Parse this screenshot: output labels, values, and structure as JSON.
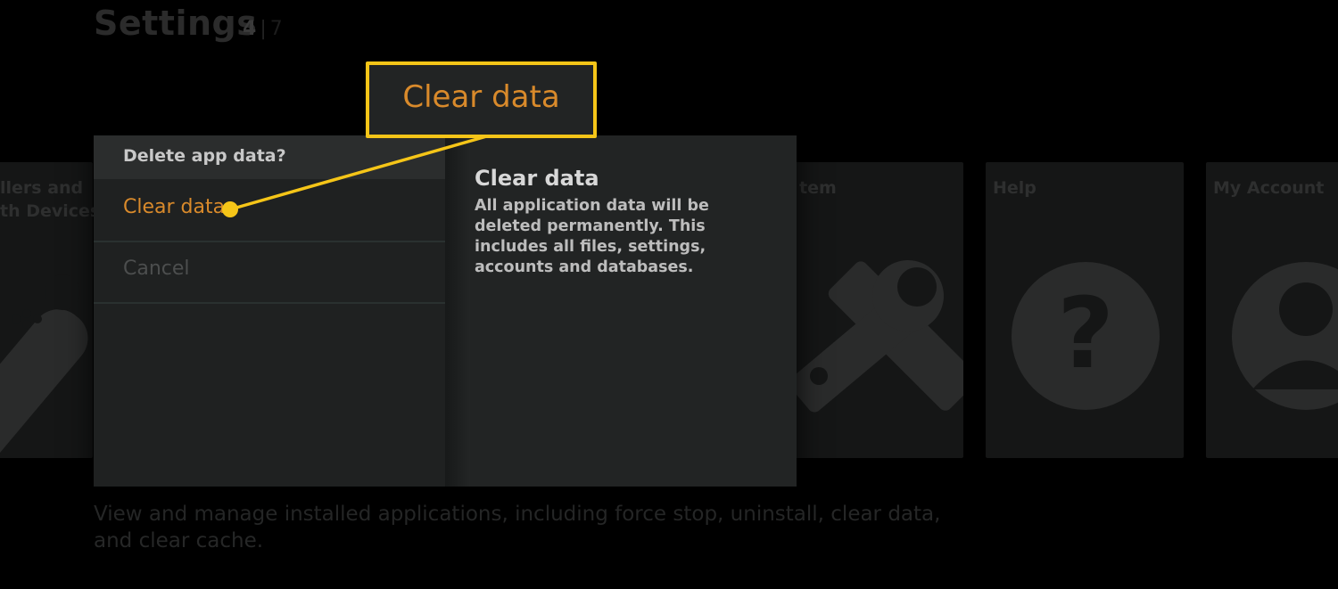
{
  "background": {
    "title": "Settings",
    "counter": {
      "current": "4",
      "separator": "|",
      "total": "7"
    },
    "tiles": [
      {
        "label": "llers and\nth Devices",
        "icon": "remote-icon"
      },
      {
        "label": "tem",
        "icon": "tools-icon"
      },
      {
        "label": "Help",
        "icon": "help-icon"
      },
      {
        "label": "My Account",
        "icon": "account-icon"
      }
    ],
    "description": "View and manage installed applications, including force stop, uninstall, clear data, and clear cache."
  },
  "dialog": {
    "heading": "Delete app data?",
    "options": [
      {
        "label": "Clear data",
        "selected": true
      },
      {
        "label": "Cancel",
        "selected": false
      }
    ],
    "detail": {
      "title": "Clear data",
      "body": "All application data will be deleted permanently. This includes all files, settings, accounts and databases."
    }
  },
  "callout": {
    "label": "Clear data",
    "border_color": "#f5c518",
    "text_color": "#d98a2b"
  },
  "colors": {
    "accent": "#d98a2b",
    "highlight": "#f5c518"
  }
}
